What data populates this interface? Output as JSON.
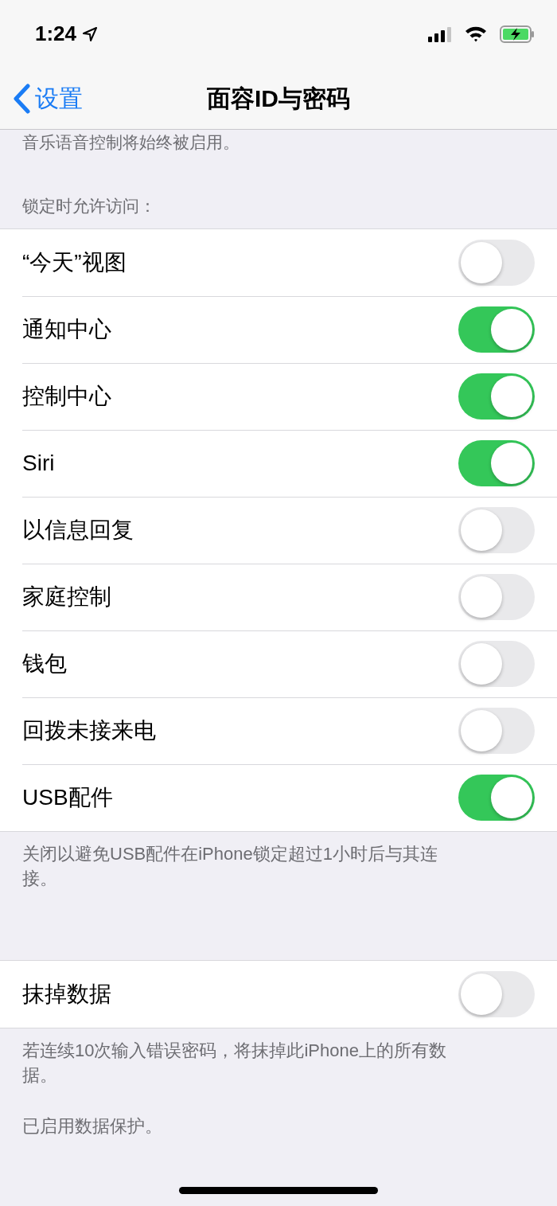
{
  "status_bar": {
    "time": "1:24"
  },
  "nav": {
    "back": "设置",
    "title": "面容ID与密码"
  },
  "top_note": "音乐语音控制将始终被启用。",
  "groups": [
    {
      "header": "锁定时允许访问：",
      "rows": [
        {
          "label": "“今天”视图",
          "on": false
        },
        {
          "label": "通知中心",
          "on": true
        },
        {
          "label": "控制中心",
          "on": true
        },
        {
          "label": "Siri",
          "on": true
        },
        {
          "label": "以信息回复",
          "on": false
        },
        {
          "label": "家庭控制",
          "on": false
        },
        {
          "label": "钱包",
          "on": false
        },
        {
          "label": "回拨未接来电",
          "on": false
        },
        {
          "label": "USB配件",
          "on": true
        }
      ],
      "footer": [
        "关闭以避免USB配件在iPhone锁定超过1小时后与其连接。"
      ]
    },
    {
      "rows": [
        {
          "label": "抹掉数据",
          "on": false
        }
      ],
      "footer": [
        "若连续10次输入错误密码，将抹掉此iPhone上的所有数据。",
        "已启用数据保护。"
      ]
    }
  ]
}
